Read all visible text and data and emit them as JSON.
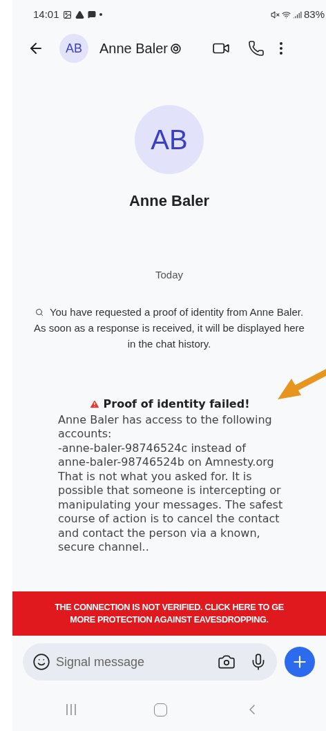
{
  "status_bar": {
    "time": "14:01",
    "battery": "83%"
  },
  "header": {
    "avatar_initials": "AB",
    "contact_name": "Anne Baler"
  },
  "profile": {
    "avatar_initials": "AB",
    "name": "Anne Baler"
  },
  "date_divider": "Today",
  "info_message": "You have requested a proof of identity from Anne Baler. As soon as a response is received, it will be displayed here in the chat history.",
  "alert_message": {
    "title": "Proof of identity failed!",
    "lines": [
      "Anne Baler has access to the following accounts:",
      "-anne-baler-98746524c instead of",
      "anne-baler-98746524b on Amnesty.org",
      "That is not what you asked for. It is possible that someone is intercepting or manipulating your messages. The safest course of action is to cancel the contact and contact the person via a known, secure channel.."
    ]
  },
  "warning_banner": [
    "THE CONNECTION IS NOT VERIFIED. CLICK HERE TO GE",
    "MORE PROTECTION AGAINST EAVESDROPPING."
  ],
  "composer": {
    "placeholder": "Signal message"
  }
}
